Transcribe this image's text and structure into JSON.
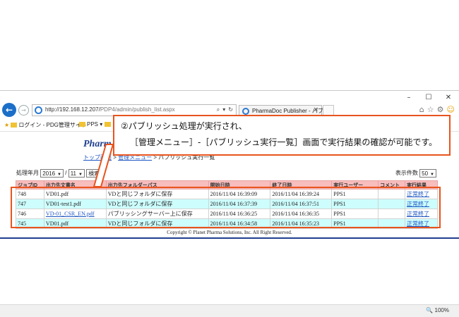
{
  "browser": {
    "window_controls": [
      "–",
      "☐",
      "✕"
    ],
    "url_host": "http://192.168.12.207/",
    "url_path": "PDP4/admin/publish_list.aspx",
    "addr_tools": [
      "⌕",
      "▾",
      "↻"
    ],
    "tab_title": "PharmaDoc Publisher - パブ...",
    "favorites": [
      "ログイン - PDG管理サイト",
      "PPS ▾"
    ]
  },
  "page": {
    "brand": "Pharm",
    "breadcrumb_top": "トップ画面",
    "breadcrumb_sep": " > ",
    "breadcrumb_menu": "管理メニュー",
    "breadcrumb_current": "パブリッシュ実行一覧",
    "filter": {
      "label": "処理年月",
      "year": "2016",
      "month_sep": "/",
      "month": "11",
      "button": "検索"
    },
    "page_size_label": "表示件数",
    "page_size": "50",
    "columns": [
      "ジョブID",
      "出力先文書名",
      "出力先フォルダーパス",
      "開始日時",
      "終了日時",
      "実行ユーザー",
      "コメント",
      "実行結果"
    ],
    "rows": [
      {
        "id": "748",
        "name": "VD01.pdf",
        "path": "VDと同じフォルダに保存",
        "start": "2016/11/04 16:39:09",
        "end": "2016/11/04 16:39:24",
        "user": "PPS1",
        "comment": "",
        "result": "正常終了"
      },
      {
        "id": "747",
        "name": "VD01-test1.pdf",
        "path": "VDと同じフォルダに保存",
        "start": "2016/11/04 16:37:39",
        "end": "2016/11/04 16:37:51",
        "user": "PPS1",
        "comment": "",
        "result": "正常終了"
      },
      {
        "id": "746",
        "name": "VD-01_CSR_EN.pdf",
        "path": "パブリッシングサーバー上に保存",
        "start": "2016/11/04 16:36:25",
        "end": "2016/11/04 16:36:35",
        "user": "PPS1",
        "comment": "",
        "result": "正常終了"
      },
      {
        "id": "745",
        "name": "VD01.pdf",
        "path": "VDと同じフォルダに保存",
        "start": "2016/11/04 16:34:58",
        "end": "2016/11/04 16:35:23",
        "user": "PPS1",
        "comment": "",
        "result": "正常終了"
      }
    ],
    "copyright": "Copyright © Planet Pharma Solutions, Inc. All Right Reserved."
  },
  "statusbar": {
    "zoom": "🔍 100%"
  },
  "annotation": {
    "line1": "②パブリッシュ処理が実行され、",
    "line2": "［管理メニュー］-［パブリッシュ実行一覧］画面で実行結果の確認が可能です。"
  },
  "colors": {
    "callout_border": "#e8541e",
    "header_bg": "#f8bdbd",
    "alt_row_bg": "#cdfdfd",
    "link": "#1f57c3"
  }
}
